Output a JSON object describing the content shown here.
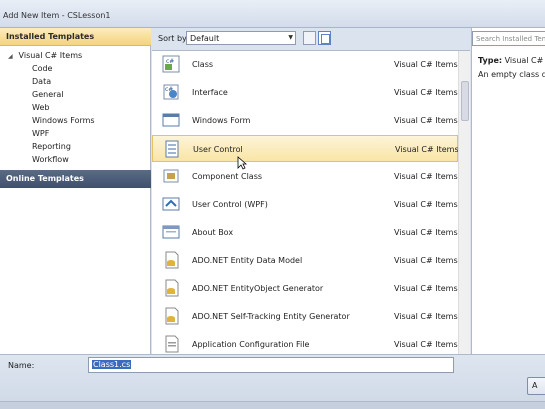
{
  "window": {
    "title": "Add New Item - CSLesson1"
  },
  "sidebar": {
    "installed_header": "Installed Templates",
    "root_label": "Visual C# Items",
    "items": [
      "Code",
      "Data",
      "General",
      "Web",
      "Windows Forms",
      "WPF",
      "Reporting",
      "Workflow"
    ],
    "online_header": "Online Templates"
  },
  "sortbar": {
    "label": "Sort by:",
    "selected": "Default"
  },
  "templates": [
    {
      "name": "Class",
      "category": "Visual C# Items",
      "icon": "class-icon"
    },
    {
      "name": "Interface",
      "category": "Visual C# Items",
      "icon": "interface-icon"
    },
    {
      "name": "Windows Form",
      "category": "Visual C# Items",
      "icon": "windows-form-icon"
    },
    {
      "name": "User Control",
      "category": "Visual C# Items",
      "icon": "user-control-icon",
      "selected": true
    },
    {
      "name": "Component Class",
      "category": "Visual C# Items",
      "icon": "component-class-icon"
    },
    {
      "name": "User Control (WPF)",
      "category": "Visual C# Items",
      "icon": "wpf-user-control-icon"
    },
    {
      "name": "About Box",
      "category": "Visual C# Items",
      "icon": "about-box-icon"
    },
    {
      "name": "ADO.NET Entity Data Model",
      "category": "Visual C# Items",
      "icon": "entity-model-icon"
    },
    {
      "name": "ADO.NET EntityObject Generator",
      "category": "Visual C# Items",
      "icon": "entity-generator-icon"
    },
    {
      "name": "ADO.NET Self-Tracking Entity Generator",
      "category": "Visual C# Items",
      "icon": "self-tracking-generator-icon"
    },
    {
      "name": "Application Configuration File",
      "category": "Visual C# Items",
      "icon": "config-file-icon"
    }
  ],
  "details": {
    "search_placeholder": "Search Installed Tem",
    "type_label": "Type:",
    "type_value": "Visual C# It",
    "description": "An empty class defi"
  },
  "footer": {
    "name_label": "Name:",
    "name_value": "Class1.cs",
    "add_button": "A"
  }
}
